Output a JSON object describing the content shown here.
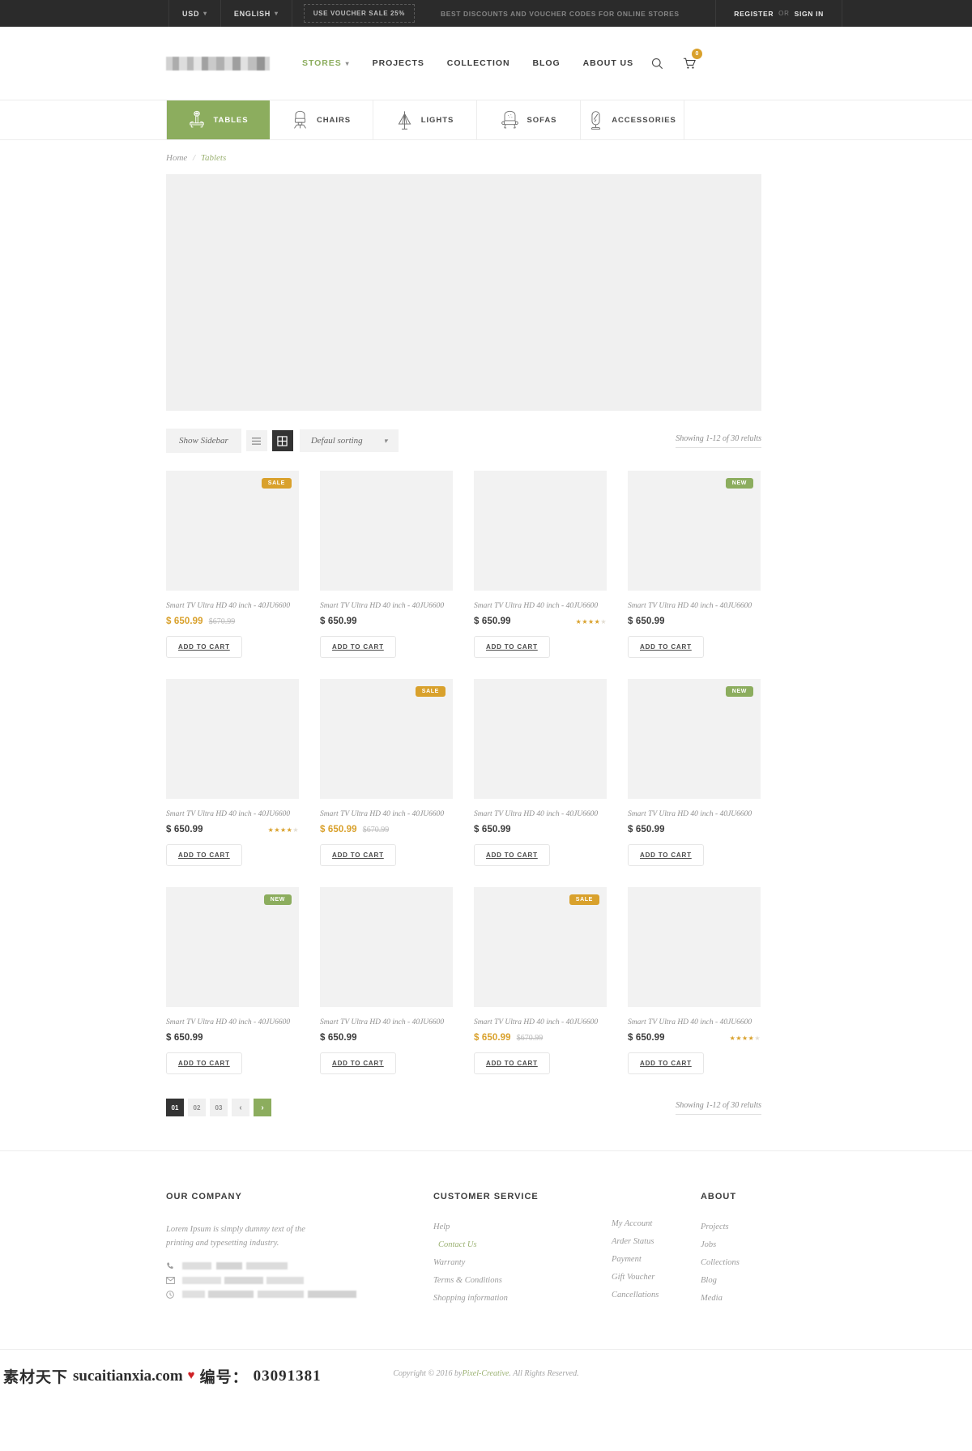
{
  "topbar": {
    "currency": "USD",
    "language": "ENGLISH",
    "voucher_badge": "USE VOUCHER SALE 25%",
    "voucher_text": "BEST DISCOUNTS AND VOUCHER CODES FOR ONLINE STORES",
    "register": "REGISTER",
    "or": "OR",
    "signin": "SIGN IN"
  },
  "header": {
    "nav": [
      {
        "label": "STORES",
        "active": true,
        "caret": true
      },
      {
        "label": "PROJECTS",
        "active": false,
        "caret": false
      },
      {
        "label": "COLLECTION",
        "active": false,
        "caret": false
      },
      {
        "label": "BLOG",
        "active": false,
        "caret": false
      },
      {
        "label": "ABOUT US",
        "active": false,
        "caret": false
      }
    ],
    "cart_count": "0"
  },
  "categories": [
    {
      "label": "TABLES",
      "icon": "table-icon",
      "active": true
    },
    {
      "label": "CHAIRS",
      "icon": "chair-icon",
      "active": false
    },
    {
      "label": "LIGHTS",
      "icon": "lamp-icon",
      "active": false
    },
    {
      "label": "SOFAS",
      "icon": "sofa-icon",
      "active": false
    },
    {
      "label": "ACCESSORIES",
      "icon": "mirror-icon",
      "active": false
    }
  ],
  "breadcrumb": {
    "home": "Home",
    "separator": "/",
    "current": "Tablets"
  },
  "toolbar": {
    "show_sidebar": "Show Sidebar",
    "sorting_label": "Defaul sorting",
    "results_text": "Showing 1-12 of 30 relults",
    "list_view_icon": "list-view-icon",
    "grid_view_icon": "grid-view-icon",
    "active_view": "grid"
  },
  "products": [
    {
      "title": "Smart TV Ultra HD 40 inch - 40JU6600",
      "price": "$ 650.99",
      "old_price": "$670.99",
      "on_sale": true,
      "badge": "SALE",
      "rating": 0,
      "cart_label": "ADD TO CART"
    },
    {
      "title": "Smart TV Ultra HD 40 inch - 40JU6600",
      "price": "$ 650.99",
      "old_price": "",
      "on_sale": false,
      "badge": "",
      "rating": 0,
      "cart_label": "ADD TO CART"
    },
    {
      "title": "Smart TV Ultra HD 40 inch - 40JU6600",
      "price": "$ 650.99",
      "old_price": "",
      "on_sale": false,
      "badge": "",
      "rating": 4,
      "cart_label": "ADD TO CART"
    },
    {
      "title": "Smart TV Ultra HD 40 inch - 40JU6600",
      "price": "$ 650.99",
      "old_price": "",
      "on_sale": false,
      "badge": "NEW",
      "rating": 0,
      "cart_label": "ADD TO CART"
    },
    {
      "title": "Smart TV Ultra HD 40 inch - 40JU6600",
      "price": "$ 650.99",
      "old_price": "",
      "on_sale": false,
      "badge": "",
      "rating": 4,
      "cart_label": "ADD TO CART"
    },
    {
      "title": "Smart TV Ultra HD 40 inch - 40JU6600",
      "price": "$ 650.99",
      "old_price": "$670.99",
      "on_sale": true,
      "badge": "SALE",
      "rating": 0,
      "cart_label": "ADD TO CART"
    },
    {
      "title": "Smart TV Ultra HD 40 inch - 40JU6600",
      "price": "$ 650.99",
      "old_price": "",
      "on_sale": false,
      "badge": "",
      "rating": 0,
      "cart_label": "ADD TO CART"
    },
    {
      "title": "Smart TV Ultra HD 40 inch - 40JU6600",
      "price": "$ 650.99",
      "old_price": "",
      "on_sale": false,
      "badge": "NEW",
      "rating": 0,
      "cart_label": "ADD TO CART"
    },
    {
      "title": "Smart TV Ultra HD 40 inch - 40JU6600",
      "price": "$ 650.99",
      "old_price": "",
      "on_sale": false,
      "badge": "NEW",
      "rating": 0,
      "cart_label": "ADD TO CART"
    },
    {
      "title": "Smart TV Ultra HD 40 inch - 40JU6600",
      "price": "$ 650.99",
      "old_price": "",
      "on_sale": false,
      "badge": "",
      "rating": 0,
      "cart_label": "ADD TO CART"
    },
    {
      "title": "Smart TV Ultra HD 40 inch - 40JU6600",
      "price": "$ 650.99",
      "old_price": "$670.99",
      "on_sale": true,
      "badge": "SALE",
      "rating": 0,
      "cart_label": "ADD TO CART"
    },
    {
      "title": "Smart TV Ultra HD 40 inch - 40JU6600",
      "price": "$ 650.99",
      "old_price": "",
      "on_sale": false,
      "badge": "",
      "rating": 4,
      "cart_label": "ADD TO CART"
    }
  ],
  "pagination": {
    "pages": [
      "01",
      "02",
      "03"
    ],
    "active_page": "01",
    "prev_icon": "chevron-left-icon",
    "next_icon": "chevron-right-icon",
    "results_text": "Showing 1-12 of 30 relults"
  },
  "footer": {
    "company": {
      "heading": "OUR COMPANY",
      "description": "Lorem Ipsum is simply dummy text of the printing and typesetting industry.",
      "phone_icon": "phone-icon",
      "mail_icon": "envelope-icon",
      "clock_icon": "clock-icon"
    },
    "customer_service": {
      "heading": "CUSTOMER SERVICE",
      "col1": [
        {
          "label": "Help",
          "active": false
        },
        {
          "label": "Contact Us",
          "active": true
        },
        {
          "label": "Warranty",
          "active": false
        },
        {
          "label": "Terms & Conditions",
          "active": false
        },
        {
          "label": "Shopping information",
          "active": false
        }
      ],
      "col2": [
        {
          "label": "My Account",
          "active": false
        },
        {
          "label": "Arder Status",
          "active": false
        },
        {
          "label": "Payment",
          "active": false
        },
        {
          "label": "Gift Voucher",
          "active": false
        },
        {
          "label": "Cancellations",
          "active": false
        }
      ]
    },
    "about": {
      "heading": "ABOUT",
      "links": [
        {
          "label": "Projects",
          "active": false
        },
        {
          "label": "Jobs",
          "active": false
        },
        {
          "label": "Collections",
          "active": false
        },
        {
          "label": "Blog",
          "active": false
        },
        {
          "label": "Media",
          "active": false
        }
      ]
    }
  },
  "copyright": {
    "prefix": "Copyright © 2016 by ",
    "brand": "Pixel-Creative",
    "suffix": ". All Rights Reserved."
  },
  "watermark": {
    "cn": "素材天下",
    "url": "sucaitianxia.com",
    "heart": "♥",
    "number_label": "编号：",
    "number": "03091381"
  },
  "colors": {
    "accent_green": "#8cad5e",
    "accent_gold": "#d9a12c",
    "dark": "#2b2b2b",
    "placeholder_gray": "#f2f2f2"
  }
}
